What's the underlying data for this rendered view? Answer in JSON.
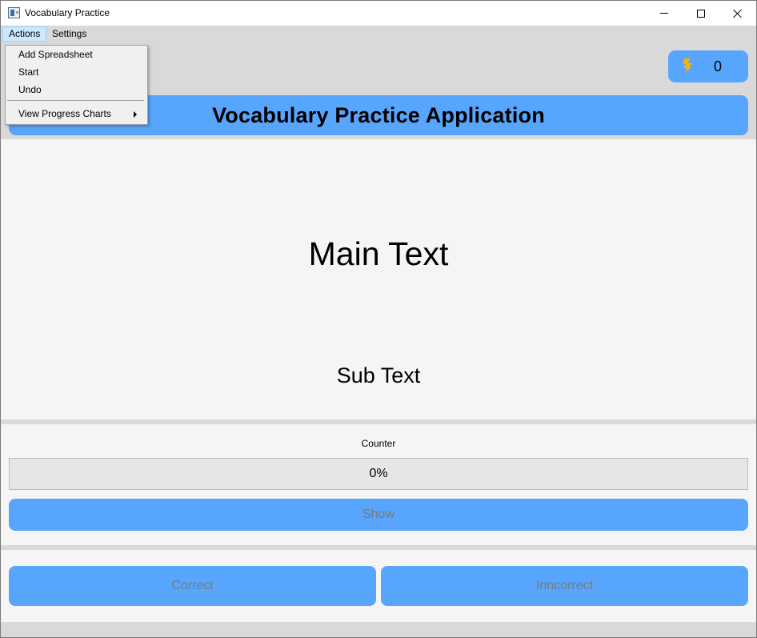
{
  "window": {
    "title": "Vocabulary Practice",
    "controls": [
      "minimize",
      "maximize",
      "close"
    ]
  },
  "menubar": {
    "actions": "Actions",
    "settings": "Settings"
  },
  "actions_menu": {
    "items": [
      "Add Spreadsheet",
      "Start",
      "Undo",
      "View Progress Charts"
    ],
    "submenu_item": "View Progress Charts"
  },
  "streak": {
    "icon": "lightning-bolt-icon",
    "count": "0"
  },
  "banner": {
    "title": "Vocabulary Practice Application"
  },
  "card": {
    "main_text": "Main Text",
    "sub_text": "Sub Text"
  },
  "counter": {
    "label": "Counter",
    "progress_text": "0%",
    "progress_value": 0
  },
  "buttons": {
    "show": "Show",
    "correct": "Correct",
    "incorrect": "Inncorrect"
  },
  "colors": {
    "accent": "#57a5fc",
    "background": "#d9d9d9",
    "panel": "#f5f5f5",
    "disabled_text": "#7a7a7a",
    "bolt": "#f5b400"
  }
}
